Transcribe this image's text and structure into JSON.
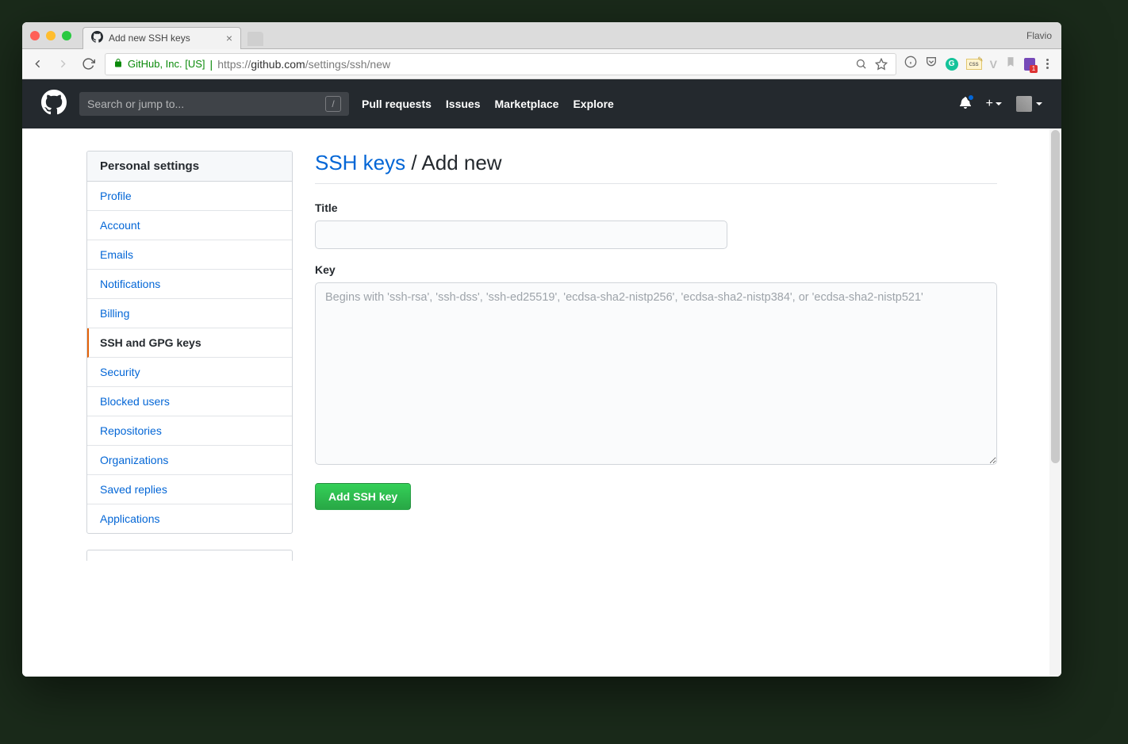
{
  "browser": {
    "profile_name": "Flavio",
    "tab_title": "Add new SSH keys",
    "address": {
      "company": "GitHub, Inc. [US]",
      "protocol": "https://",
      "host": "github.com",
      "path": "/settings/ssh/new"
    }
  },
  "header": {
    "search_placeholder": "Search or jump to...",
    "slash_key": "/",
    "nav": {
      "pull_requests": "Pull requests",
      "issues": "Issues",
      "marketplace": "Marketplace",
      "explore": "Explore"
    },
    "plus_label": "+"
  },
  "sidebar": {
    "header": "Personal settings",
    "items": [
      {
        "label": "Profile",
        "key": "profile"
      },
      {
        "label": "Account",
        "key": "account"
      },
      {
        "label": "Emails",
        "key": "emails"
      },
      {
        "label": "Notifications",
        "key": "notifications"
      },
      {
        "label": "Billing",
        "key": "billing"
      },
      {
        "label": "SSH and GPG keys",
        "key": "ssh-gpg",
        "active": true
      },
      {
        "label": "Security",
        "key": "security"
      },
      {
        "label": "Blocked users",
        "key": "blocked"
      },
      {
        "label": "Repositories",
        "key": "repositories"
      },
      {
        "label": "Organizations",
        "key": "organizations"
      },
      {
        "label": "Saved replies",
        "key": "saved-replies"
      },
      {
        "label": "Applications",
        "key": "applications"
      }
    ]
  },
  "main": {
    "breadcrumb_link": "SSH keys",
    "breadcrumb_sep": " / ",
    "breadcrumb_current": "Add new",
    "title_label": "Title",
    "title_value": "",
    "key_label": "Key",
    "key_value": "",
    "key_placeholder": "Begins with 'ssh-rsa', 'ssh-dss', 'ssh-ed25519', 'ecdsa-sha2-nistp256', 'ecdsa-sha2-nistp384', or 'ecdsa-sha2-nistp521'",
    "submit_label": "Add SSH key"
  }
}
